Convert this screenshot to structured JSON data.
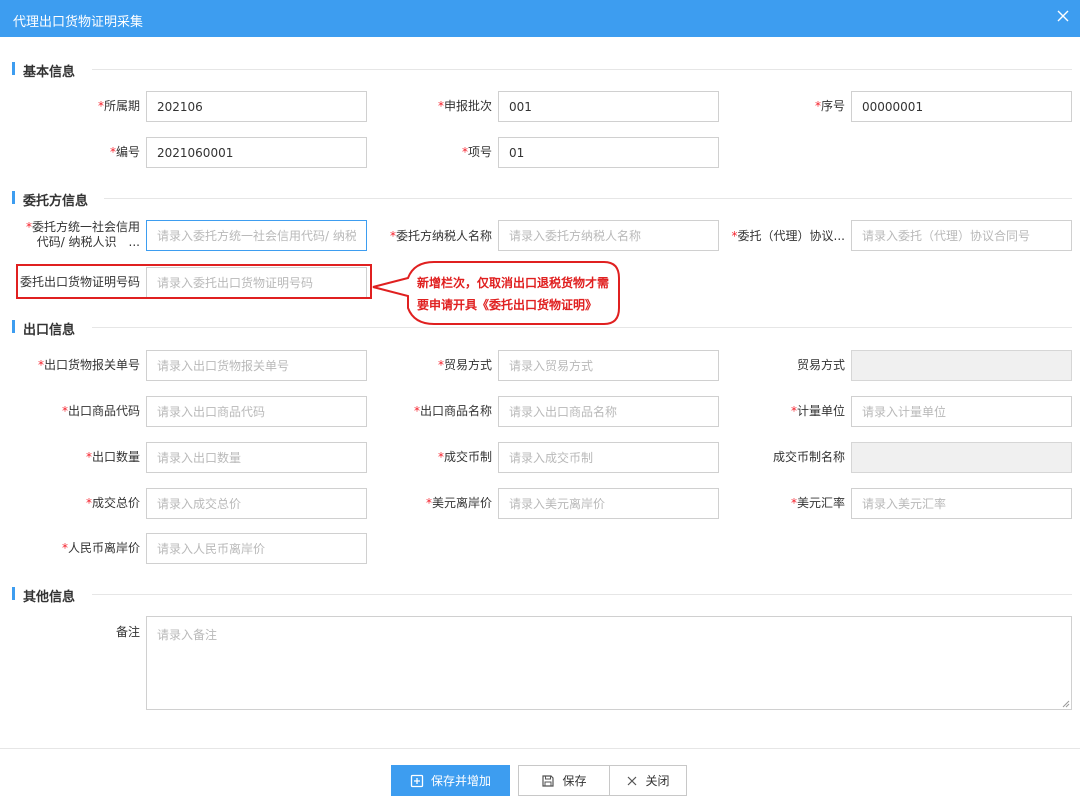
{
  "dialog": {
    "title": "代理出口货物证明采集"
  },
  "sections": {
    "basic": "基本信息",
    "entrust": "委托方信息",
    "export": "出口信息",
    "other": "其他信息"
  },
  "basic": {
    "period": {
      "label": "所属期",
      "value": "202106"
    },
    "batch": {
      "label": "申报批次",
      "value": "001"
    },
    "seq": {
      "label": "序号",
      "value": "00000001"
    },
    "code": {
      "label": "编号",
      "value": "2021060001"
    },
    "item": {
      "label": "项号",
      "value": "01"
    }
  },
  "entrust": {
    "credit_code": {
      "label": "委托方统一社会信用代码/ 纳税人识　...",
      "placeholder": "请录入委托方统一社会信用代码/ 纳税人识"
    },
    "taxpayer_name": {
      "label": "委托方纳税人名称",
      "placeholder": "请录入委托方纳税人名称"
    },
    "agreement": {
      "label": "委托（代理）协议...",
      "placeholder": "请录入委托（代理）协议合同号"
    },
    "cert_no": {
      "label": "委托出口货物证明号码",
      "placeholder": "请录入委托出口货物证明号码"
    }
  },
  "annotation": {
    "line1": "新增栏次，仅取消出口退税货物才需",
    "line2": "要申请开具《委托出口货物证明》"
  },
  "export": {
    "customs_no": {
      "label": "出口货物报关单号",
      "placeholder": "请录入出口货物报关单号"
    },
    "trade_mode": {
      "label": "贸易方式",
      "placeholder": "请录入贸易方式"
    },
    "trade_mode_name": {
      "label": "贸易方式"
    },
    "goods_code": {
      "label": "出口商品代码",
      "placeholder": "请录入出口商品代码"
    },
    "goods_name": {
      "label": "出口商品名称",
      "placeholder": "请录入出口商品名称"
    },
    "unit": {
      "label": "计量单位",
      "placeholder": "请录入计量单位"
    },
    "quantity": {
      "label": "出口数量",
      "placeholder": "请录入出口数量"
    },
    "currency": {
      "label": "成交币制",
      "placeholder": "请录入成交币制"
    },
    "currency_name": {
      "label": "成交币制名称"
    },
    "total": {
      "label": "成交总价",
      "placeholder": "请录入成交总价"
    },
    "usd_fob": {
      "label": "美元离岸价",
      "placeholder": "请录入美元离岸价"
    },
    "usd_rate": {
      "label": "美元汇率",
      "placeholder": "请录入美元汇率"
    },
    "rmb_fob": {
      "label": "人民币离岸价",
      "placeholder": "请录入人民币离岸价"
    }
  },
  "other": {
    "remark": {
      "label": "备注",
      "placeholder": "请录入备注"
    }
  },
  "buttons": {
    "save_add": "保存并增加",
    "save": "保存",
    "close": "关闭"
  },
  "colors": {
    "primary": "#3d9df0",
    "required": "#f5222d",
    "annotation": "#e02020"
  }
}
